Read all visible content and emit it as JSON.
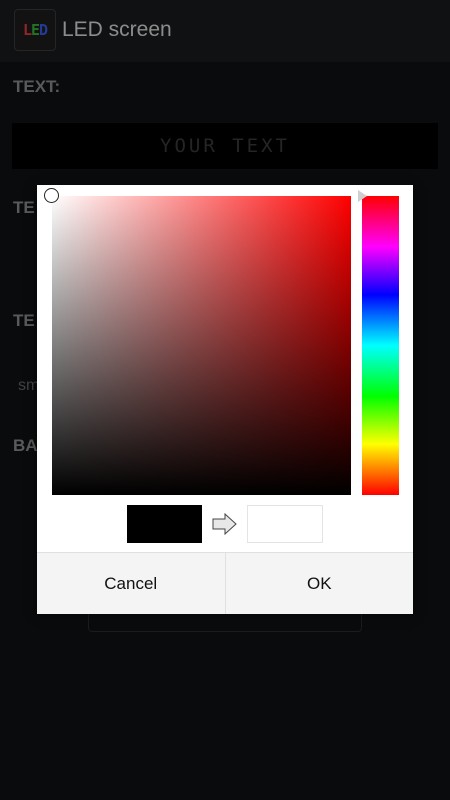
{
  "app": {
    "title": "LED screen",
    "icon_letters": [
      "L",
      "E",
      "D"
    ]
  },
  "sections": {
    "text_label": "TEXT:",
    "text_color_label_partial": "TE",
    "text_size_label_partial": "TE",
    "size_hint_partial": "sm",
    "background_label_partial": "BA"
  },
  "led_text": {
    "placeholder": "YOUR TEXT"
  },
  "color_picker": {
    "current_hue": "#ff0000",
    "old_color": "#000000",
    "new_color": "#ffffff",
    "cancel_label": "Cancel",
    "ok_label": "OK"
  }
}
